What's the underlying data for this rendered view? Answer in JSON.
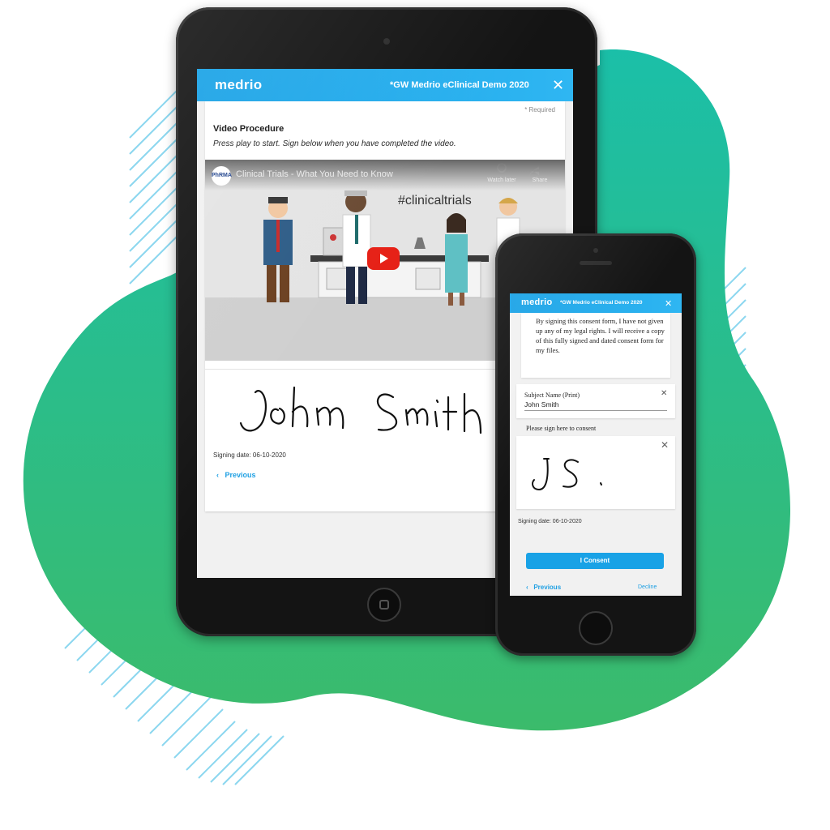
{
  "colors": {
    "accent": "#19a2e6",
    "blob_start": "#1fc2a6",
    "blob_end": "#3dbb6a",
    "stripe": "#7fd3ee",
    "play_button": "#e62117"
  },
  "tablet": {
    "brand": "medrio",
    "header_title": "*GW Medrio eClinical Demo 2020",
    "close_icon": "close-icon",
    "required_note": "* Required",
    "section_title": "Video Procedure",
    "instructions": "Press play to start. Sign below when you have completed the video.",
    "video": {
      "channel_logo": "PhRMA",
      "title": "Clinical Trials - What You Need to Know",
      "watch_later": "Watch later",
      "share": "Share",
      "hashtag": "#clinicaltrials",
      "play_icon": "play-icon"
    },
    "signature_text": "John Smith",
    "signing_date": "Signing date: 06-10-2020",
    "previous": "Previous"
  },
  "phone": {
    "brand": "medrio",
    "header_title": "*GW Medrio eClinical Demo 2020",
    "consent_text": "By signing this consent form, I have not given up any of my legal rights. I will receive a copy of this fully signed and dated consent form for my files.",
    "subject_label": "Subject Name (Print)",
    "subject_value": "John Smith",
    "sign_label": "Please sign here to consent",
    "signature_text": "JS.",
    "signing_date": "Signing date: 06-10-2020",
    "consent_button": "I Consent",
    "previous": "Previous",
    "decline": "Decline"
  }
}
